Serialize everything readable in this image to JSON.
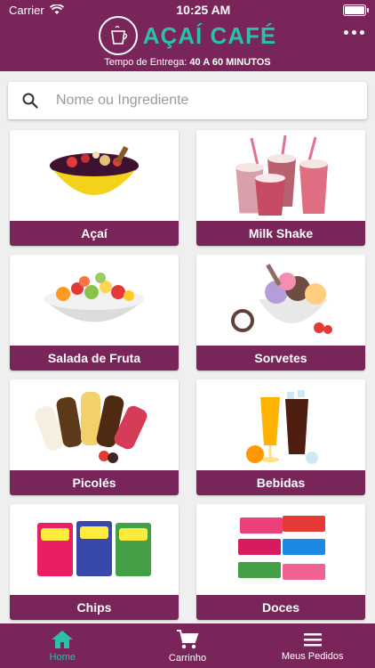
{
  "status": {
    "carrier": "Carrier",
    "time": "10:25 AM"
  },
  "header": {
    "logo_text": "Açaí Café",
    "title": "AÇAÍ CAFÉ",
    "delivery_label": "Tempo de Entrega:",
    "delivery_value": "40 A 60 MINUTOS"
  },
  "search": {
    "placeholder": "Nome ou Ingrediente"
  },
  "categories": [
    {
      "label": "Açaí",
      "icon": "acai-bowl-image"
    },
    {
      "label": "Milk Shake",
      "icon": "milkshake-image"
    },
    {
      "label": "Salada de Fruta",
      "icon": "fruit-salad-image"
    },
    {
      "label": "Sorvetes",
      "icon": "ice-cream-image"
    },
    {
      "label": "Picolés",
      "icon": "popsicle-image"
    },
    {
      "label": "Bebidas",
      "icon": "drinks-image"
    },
    {
      "label": "Chips",
      "icon": "chips-image"
    },
    {
      "label": "Doces",
      "icon": "candy-image"
    }
  ],
  "tabs": [
    {
      "label": "Home",
      "icon": "home-icon",
      "active": true
    },
    {
      "label": "Carrinho",
      "icon": "cart-icon",
      "active": false
    },
    {
      "label": "Meus Pedidos",
      "icon": "menu-list-icon",
      "active": false
    }
  ],
  "colors": {
    "brand": "#7a2559",
    "accent": "#29c2a6",
    "background": "#efefef"
  }
}
